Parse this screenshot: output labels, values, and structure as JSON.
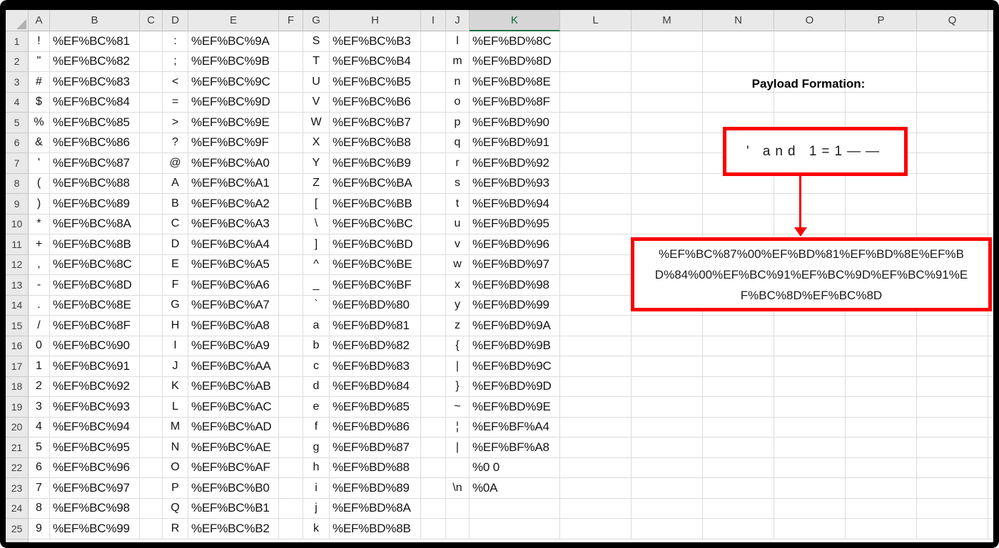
{
  "colors": {
    "annotation_red": "#FB0000",
    "selection_green": "#1B7145",
    "selected_header_text_green": "#0F6B3C",
    "header_gray": "#E9E9E9",
    "gridline_gray": "#DCDCDC"
  },
  "spreadsheet": {
    "selected_column": "K",
    "column_headers": [
      "A",
      "B",
      "C",
      "D",
      "E",
      "F",
      "G",
      "H",
      "I",
      "J",
      "K",
      "L",
      "M",
      "N",
      "O",
      "P",
      "Q"
    ],
    "rows": [
      {
        "n": "1",
        "cells": {
          "A": "!",
          "B": "%EF%BC%81",
          "D": ":",
          "E": "%EF%BC%9A",
          "G": "S",
          "H": "%EF%BC%B3",
          "J": "l",
          "K": "%EF%BD%8C"
        }
      },
      {
        "n": "2",
        "cells": {
          "A": "\"",
          "B": "%EF%BC%82",
          "D": ";",
          "E": "%EF%BC%9B",
          "G": "T",
          "H": "%EF%BC%B4",
          "J": "m",
          "K": "%EF%BD%8D"
        }
      },
      {
        "n": "3",
        "cells": {
          "A": "#",
          "B": "%EF%BC%83",
          "D": "<",
          "E": "%EF%BC%9C",
          "G": "U",
          "H": "%EF%BC%B5",
          "J": "n",
          "K": "%EF%BD%8E"
        }
      },
      {
        "n": "4",
        "cells": {
          "A": "$",
          "B": "%EF%BC%84",
          "D": "=",
          "E": "%EF%BC%9D",
          "G": "V",
          "H": "%EF%BC%B6",
          "J": "o",
          "K": "%EF%BD%8F"
        }
      },
      {
        "n": "5",
        "cells": {
          "A": "%",
          "B": "%EF%BC%85",
          "D": ">",
          "E": "%EF%BC%9E",
          "G": "W",
          "H": "%EF%BC%B7",
          "J": "p",
          "K": "%EF%BD%90"
        }
      },
      {
        "n": "6",
        "cells": {
          "A": "&",
          "B": "%EF%BC%86",
          "D": "?",
          "E": "%EF%BC%9F",
          "G": "X",
          "H": "%EF%BC%B8",
          "J": "q",
          "K": "%EF%BD%91"
        }
      },
      {
        "n": "7",
        "cells": {
          "A": "'",
          "B": "%EF%BC%87",
          "D": "@",
          "E": "%EF%BC%A0",
          "G": "Y",
          "H": "%EF%BC%B9",
          "J": "r",
          "K": "%EF%BD%92"
        }
      },
      {
        "n": "8",
        "cells": {
          "A": "(",
          "B": "%EF%BC%88",
          "D": "A",
          "E": "%EF%BC%A1",
          "G": "Z",
          "H": "%EF%BC%BA",
          "J": "s",
          "K": "%EF%BD%93"
        }
      },
      {
        "n": "9",
        "cells": {
          "A": ")",
          "B": "%EF%BC%89",
          "D": "B",
          "E": "%EF%BC%A2",
          "G": "[",
          "H": "%EF%BC%BB",
          "J": "t",
          "K": "%EF%BD%94"
        }
      },
      {
        "n": "10",
        "cells": {
          "A": "*",
          "B": "%EF%BC%8A",
          "D": "C",
          "E": "%EF%BC%A3",
          "G": "\\",
          "H": "%EF%BC%BC",
          "J": "u",
          "K": "%EF%BD%95"
        }
      },
      {
        "n": "11",
        "cells": {
          "A": "+",
          "B": "%EF%BC%8B",
          "D": "D",
          "E": "%EF%BC%A4",
          "G": "]",
          "H": "%EF%BC%BD",
          "J": "v",
          "K": "%EF%BD%96"
        }
      },
      {
        "n": "12",
        "cells": {
          "A": ",",
          "B": "%EF%BC%8C",
          "D": "E",
          "E": "%EF%BC%A5",
          "G": "^",
          "H": "%EF%BC%BE",
          "J": "w",
          "K": "%EF%BD%97"
        }
      },
      {
        "n": "13",
        "cells": {
          "A": "-",
          "B": "%EF%BC%8D",
          "D": "F",
          "E": "%EF%BC%A6",
          "G": "_",
          "H": "%EF%BC%BF",
          "J": "x",
          "K": "%EF%BD%98"
        }
      },
      {
        "n": "14",
        "cells": {
          "A": ".",
          "B": "%EF%BC%8E",
          "D": "G",
          "E": "%EF%BC%A7",
          "G": "`",
          "H": "%EF%BD%80",
          "J": "y",
          "K": "%EF%BD%99"
        }
      },
      {
        "n": "15",
        "cells": {
          "A": "/",
          "B": "%EF%BC%8F",
          "D": "H",
          "E": "%EF%BC%A8",
          "G": "a",
          "H": "%EF%BD%81",
          "J": "z",
          "K": "%EF%BD%9A"
        }
      },
      {
        "n": "16",
        "cells": {
          "A": "0",
          "B": "%EF%BC%90",
          "D": "I",
          "E": "%EF%BC%A9",
          "G": "b",
          "H": "%EF%BD%82",
          "J": "{",
          "K": "%EF%BD%9B"
        }
      },
      {
        "n": "17",
        "cells": {
          "A": "1",
          "B": "%EF%BC%91",
          "D": "J",
          "E": "%EF%BC%AA",
          "G": "c",
          "H": "%EF%BD%83",
          "J": "|",
          "K": "%EF%BD%9C"
        }
      },
      {
        "n": "18",
        "cells": {
          "A": "2",
          "B": "%EF%BC%92",
          "D": "K",
          "E": "%EF%BC%AB",
          "G": "d",
          "H": "%EF%BD%84",
          "J": "}",
          "K": "%EF%BD%9D"
        }
      },
      {
        "n": "19",
        "cells": {
          "A": "3",
          "B": "%EF%BC%93",
          "D": "L",
          "E": "%EF%BC%AC",
          "G": "e",
          "H": "%EF%BD%85",
          "J": "~",
          "K": "%EF%BD%9E"
        }
      },
      {
        "n": "20",
        "cells": {
          "A": "4",
          "B": "%EF%BC%94",
          "D": "M",
          "E": "%EF%BC%AD",
          "G": "f",
          "H": "%EF%BD%86",
          "J": "¦",
          "K": "%EF%BF%A4"
        }
      },
      {
        "n": "21",
        "cells": {
          "A": "5",
          "B": "%EF%BC%95",
          "D": "N",
          "E": "%EF%BC%AE",
          "G": "g",
          "H": "%EF%BD%87",
          "J": "|",
          "K": "%EF%BF%A8"
        }
      },
      {
        "n": "22",
        "cells": {
          "A": "6",
          "B": "%EF%BC%96",
          "D": "O",
          "E": "%EF%BC%AF",
          "G": "h",
          "H": "%EF%BD%88",
          "K": "%0 0"
        }
      },
      {
        "n": "23",
        "cells": {
          "A": "7",
          "B": "%EF%BC%97",
          "D": "P",
          "E": "%EF%BC%B0",
          "G": "i",
          "H": "%EF%BD%89",
          "J": "\\n",
          "K": "%0A"
        }
      },
      {
        "n": "24",
        "cells": {
          "A": "8",
          "B": "%EF%BC%98",
          "D": "Q",
          "E": "%EF%BC%B1",
          "G": "j",
          "H": "%EF%BD%8A"
        }
      },
      {
        "n": "25",
        "cells": {
          "A": "9",
          "B": "%EF%BC%99",
          "D": "R",
          "E": "%EF%BC%B2",
          "G": "k",
          "H": "%EF%BD%8B"
        }
      }
    ]
  },
  "annotation": {
    "title": "Payload Formation:",
    "payload_text": "' and 1=1——",
    "encoded_text": "%EF%BC%87%00%EF%BD%81%EF%BD%8E%EF%BD%84%00%EF%BC%91%EF%BC%9D%EF%BC%91%EF%BC%8D%EF%BC%8D"
  }
}
